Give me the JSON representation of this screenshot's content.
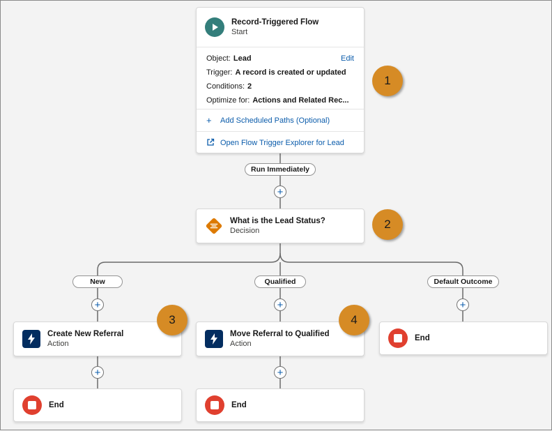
{
  "start": {
    "title": "Record-Triggered Flow",
    "subtitle": "Start",
    "object_label": "Object:",
    "object_value": "Lead",
    "edit_label": "Edit",
    "trigger_label": "Trigger:",
    "trigger_value": "A record is created or updated",
    "conditions_label": "Conditions:",
    "conditions_value": "2",
    "optimize_label": "Optimize for:",
    "optimize_value": "Actions and Related Rec...",
    "scheduled_paths": "Add Scheduled Paths (Optional)",
    "trigger_explorer": "Open Flow Trigger Explorer for Lead"
  },
  "run_immediately": "Run Immediately",
  "decision": {
    "title": "What is the Lead Status?",
    "subtitle": "Decision"
  },
  "outcomes": [
    "New",
    "Qualified",
    "Default Outcome"
  ],
  "actions": [
    {
      "title": "Create New Referral",
      "subtitle": "Action"
    },
    {
      "title": "Move Referral to Qualified",
      "subtitle": "Action"
    }
  ],
  "end_label": "End",
  "badges": [
    "1",
    "2",
    "3",
    "4"
  ],
  "colors": {
    "start_icon": "#337e7b",
    "decision_icon": "#dd7a01",
    "action_icon": "#032d60",
    "end_icon": "#e0402f",
    "badge": "#d68b25",
    "link": "#0b5cab"
  }
}
